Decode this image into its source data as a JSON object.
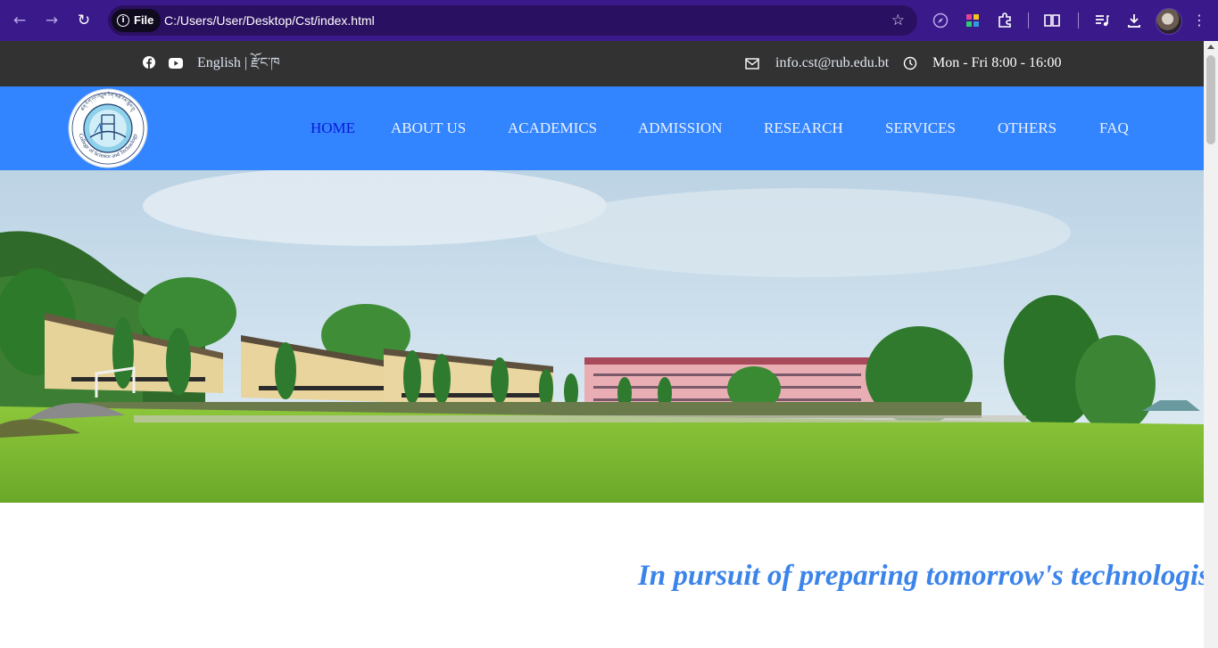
{
  "browser": {
    "url_chip": "File",
    "url": "C:/Users/User/Desktop/Cst/index.html",
    "icons": [
      "back-arrow-icon",
      "forward-arrow-icon",
      "reload-icon",
      "info-icon",
      "bookmark-star-icon",
      "compass-icon",
      "colorful-extension-icon",
      "puzzle-extensions-icon",
      "reading-mode-icon",
      "media-playlist-icon",
      "download-icon",
      "profile-avatar",
      "more-menu-icon"
    ]
  },
  "topbar": {
    "language_label": "English",
    "language_divider": "|",
    "language_alt": "རྫོང་ཁ",
    "email": "info.cst@rub.edu.bt",
    "hours": "Mon - Fri 8:00 - 16:00",
    "social_icons": [
      "facebook-icon",
      "youtube-icon"
    ]
  },
  "logo": {
    "arc_text": "College of Science and Technology",
    "top_text": "ཚན་རིག་དང་འཕྲུལ་རིག་མཐོ་རིམ་སློབ་གྲྭ"
  },
  "nav": {
    "items": [
      {
        "label": "HOME"
      },
      {
        "label": "ABOUT US"
      },
      {
        "label": "ACADEMICS"
      },
      {
        "label": "ADMISSION"
      },
      {
        "label": "RESEARCH"
      },
      {
        "label": "SERVICES"
      },
      {
        "label": "OTHERS"
      },
      {
        "label": "FAQ"
      }
    ]
  },
  "hero": {
    "tagline": "In pursuit of preparing tomorrow's technologist"
  },
  "colors": {
    "browser_frame": "#3a1a8a",
    "topbar_bg": "#333232",
    "navbar_bg": "#3384ff",
    "nav_active": "#0a1ad8",
    "tagline": "#3b84ea"
  }
}
